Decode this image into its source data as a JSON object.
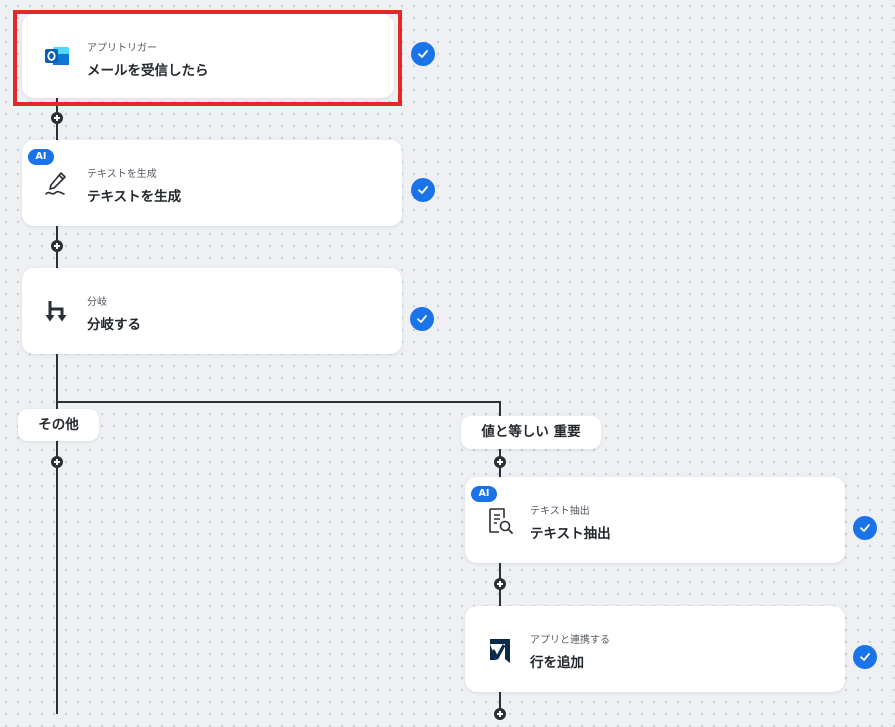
{
  "colors": {
    "accent": "#1a73e8",
    "selection": "#e22828",
    "connector": "#2b2f36",
    "canvas": "#eef0f4"
  },
  "nodes": [
    {
      "subtitle": "アプリトリガー",
      "title": "メールを受信したら",
      "icon": "outlook-icon",
      "status": "check-icon"
    },
    {
      "badge": "AI",
      "subtitle": "テキストを生成",
      "title": "テキストを生成",
      "icon": "pen-icon",
      "status": "check-icon"
    },
    {
      "subtitle": "分岐",
      "title": "分岐する",
      "icon": "branch-icon",
      "status": "check-icon"
    },
    {
      "badge": "AI",
      "subtitle": "テキスト抽出",
      "title": "テキスト抽出",
      "icon": "document-search-icon",
      "status": "check-icon"
    },
    {
      "subtitle": "アプリと連携する",
      "title": "行を追加",
      "icon": "smartsheet-icon",
      "status": "check-icon"
    }
  ],
  "branches": [
    {
      "label": "その他"
    },
    {
      "label": "値と等しい 重要"
    }
  ]
}
